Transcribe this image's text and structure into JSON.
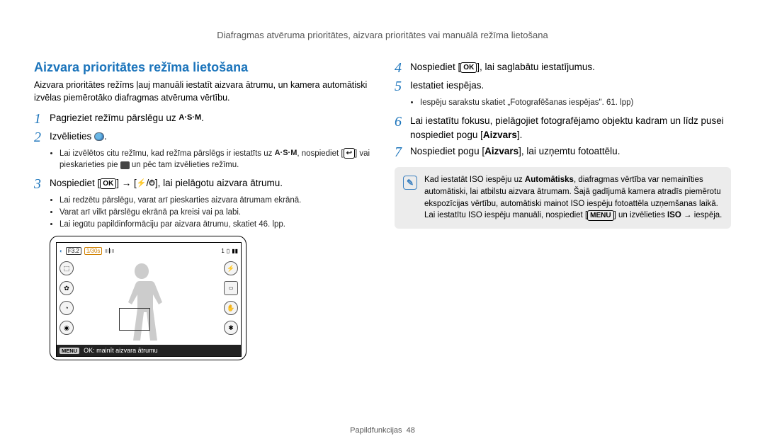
{
  "breadcrumb": "Diafragmas atvēruma prioritātes, aizvara prioritātes vai manuālā režīma lietošana",
  "title": "Aizvara prioritātes režīma lietošana",
  "intro": "Aizvara prioritātes režīms ļauj manuāli iestatīt aizvara ātrumu, un kamera automātiski izvēlas piemērotāko diafragmas atvēruma vērtību.",
  "step1_label": "1",
  "step1": "Pagrieziet režīmu pārslēgu uz ",
  "step1_end": ".",
  "asm": "A·S·M",
  "step2_label": "2",
  "step2": "Izvēlieties ",
  "step2_end": ".",
  "step2_bullet": "Lai izvēlētos citu režīmu, kad režīma pārslēgs ir iestatīts uz ",
  "step2_bullet_mid": ", nospiediet [",
  "step2_bullet_mid2": "] vai pieskarieties pie ",
  "step2_bullet_end": " un pēc tam izvēlieties režīmu.",
  "back_icon": "↩",
  "step3_label": "3",
  "step3_a": "Nospiediet [",
  "step3_b": "] → [",
  "step3_c": "/",
  "step3_d": "], lai pielāgotu aizvara ātrumu.",
  "ok": "OK",
  "flash": "⚡",
  "timer": "⏱",
  "step3_bullets": [
    "Lai redzētu pārslēgu, varat arī pieskarties aizvara ātrumam ekrānā.",
    "Varat arī vilkt pārslēgu ekrānā pa kreisi vai pa labi.",
    "Lai iegūtu papildinformāciju par aizvara ātrumu, skatiet 46. lpp."
  ],
  "lcd": {
    "f": "F3.2",
    "sh": "1/30s",
    "count": "1",
    "menu": "MENU",
    "bottom": "OK: mainīt aizvara ātrumu"
  },
  "step4_label": "4",
  "step4_a": "Nospiediet [",
  "step4_b": "], lai saglabātu iestatījumus.",
  "step5_label": "5",
  "step5": "Iestatiet iespējas.",
  "step5_b1": "Iespēju sarakstu skatiet „Fotografēšanas iespējas\". 61. lpp)",
  "step6_label": "6",
  "step6_a": "Lai iestatītu fokusu, pielāgojiet fotografējamo objektu kadram un līdz pusei nospiediet pogu [",
  "step6_b": "Aizvars",
  "step6_c": "].",
  "step7_label": "7",
  "step7_a": "Nospiediet pogu [",
  "step7_b": "Aizvars",
  "step7_c": "], lai uzņemtu fotoattēlu.",
  "note_a": "Kad iestatāt ISO iespēju uz ",
  "note_auto": "Automātisks",
  "note_b": ", diafragmas vērtība var nemainīties automātiski, lai atbilstu aizvara ātrumam. Šajā gadījumā kamera atradīs piemērotu ekspozīcijas vērtību, automātiski mainot ISO iespēju fotoattēla uzņemšanas laikā. Lai iestatītu ISO iespēju manuāli, nospiediet [",
  "menu": "MENU",
  "note_c": "] un izvēlieties ",
  "note_iso": "ISO",
  "note_d": " → iespēja.",
  "footer_label": "Papildfunkcijas",
  "footer_page": "48"
}
